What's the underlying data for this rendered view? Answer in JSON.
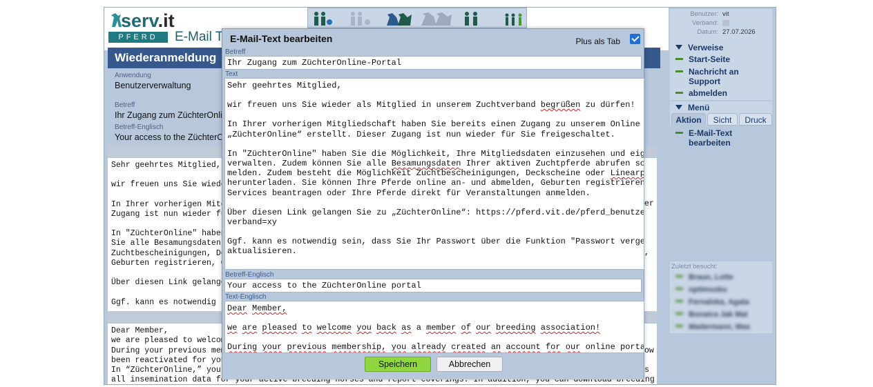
{
  "app": {
    "logo_main": "serv",
    "logo_suffix": ".it",
    "badge": "PFERD",
    "title_partial": "E-Mail Te"
  },
  "page": {
    "heading": "Wiederanmeldung",
    "fields": [
      {
        "label": "Anwendung",
        "value": "Benutzerverwaltung"
      },
      {
        "label": "Betreff",
        "value": "Ihr Zugang zum ZüchterOnline"
      },
      {
        "label": "Betreff-Englisch",
        "value": "Your access to the ZüchterOnl"
      }
    ],
    "de_lines": [
      "Sehr geehrtes Mitglied,",
      "",
      "wir freuen uns Sie wieder",
      "",
      "In Ihrer vorherigen Mitgl",
      "Zugang ist nun wieder für",
      "",
      "In \"ZüchterOnline\" haben",
      "Sie alle Besamungsdaten I",
      "Zuchtbescheinigungen, Dec",
      "Geburten registrieren, Ge",
      "",
      "Über diesen Link gelangen",
      "",
      "Ggf. kann es notwendig se"
    ],
    "de_right_fragments": [
      "er",
      ","
    ],
    "en_lines": [
      "Dear Member,",
      "we are pleased to welcome",
      "During your previous memb",
      "been reactivated for you.",
      "In “ZüchterOnline,” you h",
      "all insemination data for your active breeding horses and report coverings. In addition, you can download breeding"
    ],
    "en_right_fragments": [
      "ow",
      "s"
    ]
  },
  "user": {
    "labels": [
      "Benutzer:",
      "Verband:",
      "Datum:"
    ],
    "values": [
      "vit",
      "",
      "27.07.2026"
    ]
  },
  "links": {
    "title": "Verweise",
    "items": [
      "Start-Seite",
      "Nachricht an Support",
      "abmelden"
    ]
  },
  "menu": {
    "title": "Menü",
    "tabs": [
      "Aktion",
      "Sicht",
      "Druck"
    ],
    "items": [
      "E-Mail-Text bearbeiten"
    ]
  },
  "recent": {
    "title": "Zuletzt besucht:",
    "items": [
      "Braun, Lotte",
      "optimusku",
      "Fernalska, Agata",
      "Bonaica Jak Mal",
      "Madermann, Max"
    ]
  },
  "modal": {
    "title": "E-Mail-Text bearbeiten",
    "tab_option": "Plus als Tab",
    "tab_checked": true,
    "subject_label": "Betreff",
    "subject": "Ihr Zugang zum ZüchterOnline-Portal",
    "text_label": "Text",
    "text_lines": [
      "Sehr geehrtes Mitglied,",
      "",
      "wir freuen uns Sie wieder als Mitglied in unserem Zuchtverband begrüßen zu dürfen!",
      "",
      "In Ihrer vorherigen Mitgliedschaft haben Sie bereits einen Zugang zu unserem Online Portal",
      "„ZüchterOnline“ erstellt. Dieser Zugang ist nun wieder für Sie freigeschaltet.",
      "",
      "In \"ZüchterOnline\" haben Sie die Möglichkeit, Ihre Mitgliedsdaten einzusehen und eigenständig z",
      "verwalten. Zudem können Sie alle Besamungsdaten Ihrer aktiven Zuchtpferde abrufen sowie Bedeckun",
      "melden. Zudem besteht die Möglichkeit Zuchtbescheinigungen, Deckscheine oder Linearprofile dire",
      "herunterladen. Sie können Ihre Pferde online an- und abmelden, Geburten registrieren, Genomisch",
      "Services beantragen oder Ihre Pferde direkt für Veranstaltungen anmelden.",
      "",
      "Über diesen Link gelangen Sie zu „ZüchterOnline“: https://pferd.vit.de/pferd_benutzerverwaltung",
      "verband=xy",
      "",
      "Ggf. kann es notwendig sein, dass Sie Ihr Passwort über die Funktion \"Passwort vergessen\"",
      "aktualisieren."
    ],
    "subject_en_label": "Betreff-Englisch",
    "subject_en": "Your access to the ZüchterOnline portal",
    "text_en_label": "Text-Englisch",
    "text_en_lines": [
      "Dear Member,",
      "",
      "we are pleased to welcome you back as a member of our breeding association!",
      "",
      "During your previous membership, you already created an account for our online portal"
    ],
    "save_label": "Speichern",
    "cancel_label": "Abbrechen"
  },
  "colors": {
    "accent": "#35598c",
    "panel": "#b7c7dc",
    "save": "#8fd63f",
    "checkbox": "#1f6fd6"
  }
}
